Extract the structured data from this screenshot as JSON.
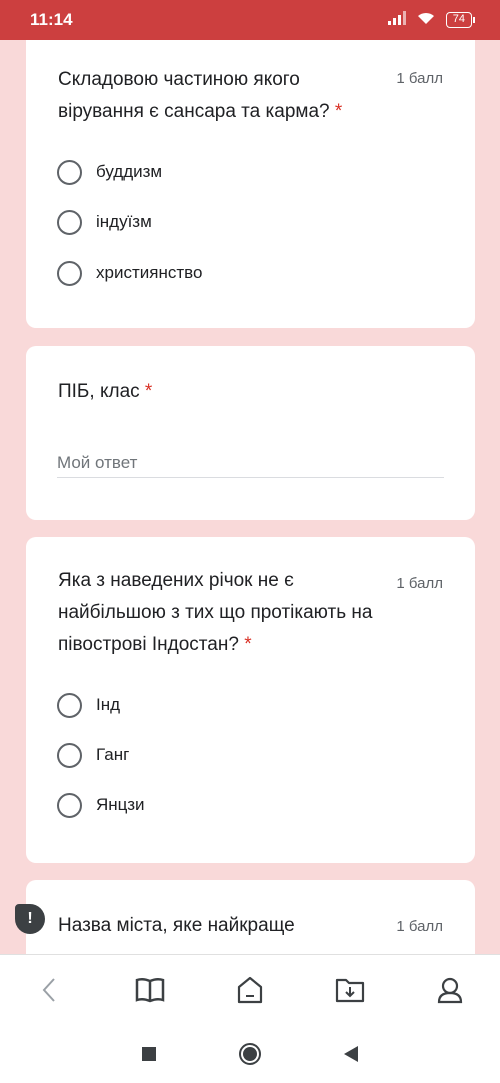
{
  "status": {
    "time": "11:14",
    "battery": "74"
  },
  "questions": [
    {
      "title": "Складовою частиною якого вірування є сансара та карма?",
      "required": "*",
      "points": "1 балл",
      "options": [
        "буддизм",
        "індуїзм",
        "християнство"
      ]
    },
    {
      "title": "ПІБ, клас",
      "required": "*",
      "placeholder": "Мой ответ"
    },
    {
      "title": "Яка з наведених річок не є найбільшою з тих що протікають на півострові Індостан?",
      "required": "*",
      "points": "1 балл",
      "options": [
        "Інд",
        "Ганг",
        "Янцзи"
      ]
    },
    {
      "title": "Назва міста, яке найкраще",
      "points": "1 балл"
    }
  ],
  "fab": {
    "label": "!"
  },
  "browser_nav": [
    "back-icon",
    "book-icon",
    "home-icon",
    "download-icon",
    "account-icon"
  ],
  "system_nav": [
    "recents-icon",
    "home-icon",
    "back-icon"
  ],
  "colors": {
    "accent": "#cc3f3f",
    "background": "#f9d9d9",
    "required": "#d93025"
  }
}
